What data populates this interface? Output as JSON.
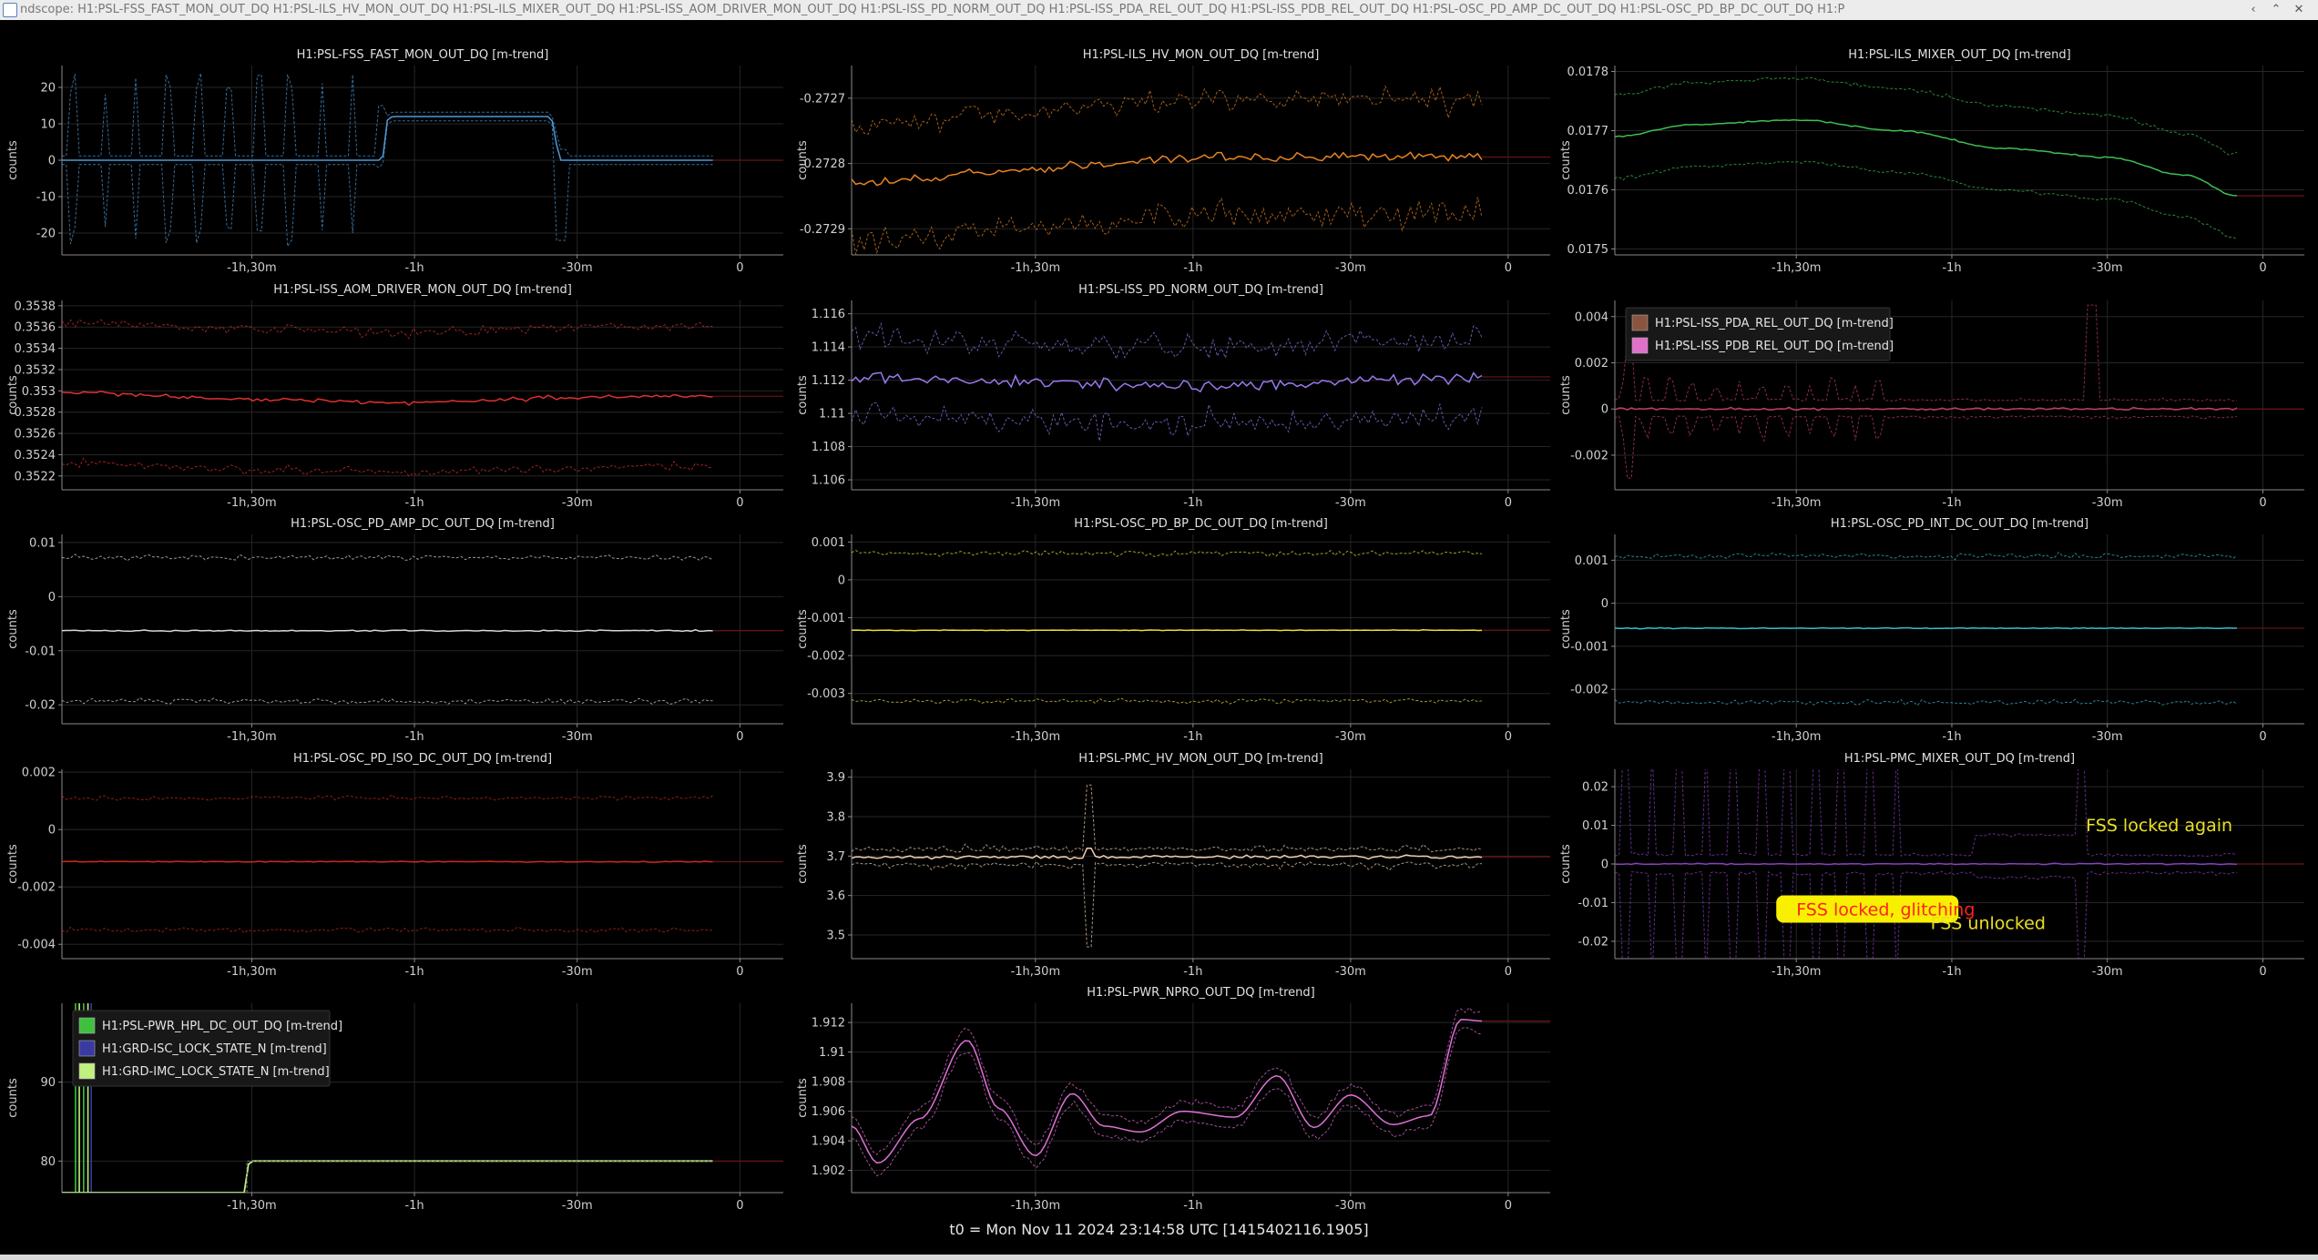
{
  "window": {
    "title": "ndscope: H1:PSL-FSS_FAST_MON_OUT_DQ H1:PSL-ILS_HV_MON_OUT_DQ H1:PSL-ILS_MIXER_OUT_DQ H1:PSL-ISS_AOM_DRIVER_MON_OUT_DQ H1:PSL-ISS_PD_NORM_OUT_DQ H1:PSL-ISS_PDA_REL_OUT_DQ H1:PSL-ISS_PDB_REL_OUT_DQ H1:PSL-OSC_PD_AMP_DC_OUT_DQ H1:PSL-OSC_PD_BP_DC_OUT_DQ H1:P",
    "minimize_glyph": "‹",
    "maximize_glyph": "⌃",
    "close_glyph": "✕"
  },
  "footer_text": "t0 = Mon Nov 11 2024 23:14:58 UTC [1415402116.1905]",
  "colors": {
    "background": "#000000",
    "grid": "#262626",
    "axis": "#8a8a8a",
    "zero_line": "#6b1515"
  },
  "x_axis": {
    "unit": "minutes relative to t0",
    "range": [
      -125,
      8
    ],
    "ticks": [
      -90,
      -60,
      -30,
      0
    ],
    "tick_labels": [
      "-1h,30m",
      "-1h",
      "-30m",
      "0"
    ],
    "data_end": -5
  },
  "chart_data": [
    {
      "type": "line",
      "title": "H1:PSL-FSS_FAST_MON_OUT_DQ [m-trend]",
      "ylabel": "counts",
      "ylim": [
        -26,
        26
      ],
      "yticks": [
        -20,
        -10,
        0,
        10,
        20
      ],
      "ytick_labels": [
        "-20",
        "-10",
        "0",
        "10",
        "20"
      ],
      "series": [
        {
          "color": "#4a9ad8",
          "kind": "fss_fast",
          "mean": [
            [
              -125,
              0
            ],
            [
              -66,
              0
            ],
            [
              -65,
              11
            ],
            [
              -64,
              12
            ],
            [
              -35,
              12
            ],
            [
              -33,
              0
            ],
            [
              -5,
              0
            ]
          ],
          "band": [
            -22,
            22
          ]
        }
      ]
    },
    {
      "type": "line",
      "title": "H1:PSL-ILS_HV_MON_OUT_DQ [m-trend]",
      "ylabel": "counts",
      "ylim": [
        -0.27294,
        -0.27265
      ],
      "yticks": [
        -0.2729,
        -0.2728,
        -0.2727
      ],
      "ytick_labels": [
        "-0.2729",
        "-0.2728",
        "-0.2727"
      ],
      "series": [
        {
          "color": "#e88420",
          "kind": "noisy",
          "mean": [
            [
              -125,
              -0.27283
            ],
            [
              -90,
              -0.27281
            ],
            [
              -60,
              -0.27279
            ],
            [
              -30,
              -0.27279
            ],
            [
              -5,
              -0.27279
            ]
          ],
          "noise": 7.5e-06,
          "band_offset": 8.5e-05
        }
      ]
    },
    {
      "type": "line",
      "title": "H1:PSL-ILS_MIXER_OUT_DQ [m-trend]",
      "ylabel": "counts",
      "ylim": [
        0.01749,
        0.01781
      ],
      "yticks": [
        0.0175,
        0.0176,
        0.0177,
        0.0178
      ],
      "ytick_labels": [
        "0.0175",
        "0.0176",
        "0.0177",
        "0.0178"
      ],
      "series": [
        {
          "color": "#3cc050",
          "kind": "smooth",
          "mean": [
            [
              -125,
              0.01769
            ],
            [
              -110,
              0.01771
            ],
            [
              -90,
              0.017718
            ],
            [
              -70,
              0.0177
            ],
            [
              -50,
              0.01767
            ],
            [
              -30,
              0.017655
            ],
            [
              -15,
              0.017625
            ],
            [
              -5,
              0.01759
            ]
          ],
          "noise": 1.2e-06,
          "band_offset": 7e-05
        }
      ]
    },
    {
      "type": "line",
      "title": "H1:PSL-ISS_AOM_DRIVER_MON_OUT_DQ [m-trend]",
      "ylabel": "counts",
      "ylim": [
        0.35207,
        0.35385
      ],
      "yticks": [
        0.3522,
        0.3524,
        0.3526,
        0.3528,
        0.353,
        0.3532,
        0.3534,
        0.3536,
        0.3538
      ],
      "ytick_labels": [
        "0.3522",
        "0.3524",
        "0.3526",
        "0.3528",
        "0.353",
        "0.3532",
        "0.3534",
        "0.3536",
        "0.3538"
      ],
      "series": [
        {
          "color": "#e03030",
          "kind": "noisy",
          "mean": [
            [
              -125,
              0.35299
            ],
            [
              -90,
              0.35292
            ],
            [
              -60,
              0.35289
            ],
            [
              -30,
              0.35294
            ],
            [
              -5,
              0.35295
            ]
          ],
          "noise": 1.8e-05,
          "band_offset": 0.00065
        }
      ]
    },
    {
      "type": "line",
      "title": "H1:PSL-ISS_PD_NORM_OUT_DQ [m-trend]",
      "ylabel": "counts",
      "ylim": [
        1.1054,
        1.1168
      ],
      "yticks": [
        1.106,
        1.108,
        1.11,
        1.112,
        1.114,
        1.116
      ],
      "ytick_labels": [
        "1.106",
        "1.108",
        "1.11",
        "1.112",
        "1.114",
        "1.116"
      ],
      "series": [
        {
          "color": "#9a78ee",
          "kind": "noisy",
          "mean": [
            [
              -125,
              1.1121
            ],
            [
              -60,
              1.1117
            ],
            [
              -30,
              1.1119
            ],
            [
              -5,
              1.1122
            ]
          ],
          "noise": 0.0003,
          "band_offset": 0.0022
        }
      ]
    },
    {
      "type": "line",
      "title": "",
      "ylabel": "counts",
      "ylim": [
        -0.0035,
        0.0047
      ],
      "yticks": [
        -0.002,
        0,
        0.002,
        0.004
      ],
      "ytick_labels": [
        "-0.002",
        "0",
        "0.002",
        "0.004"
      ],
      "legend": {
        "position": "top-left",
        "entries": [
          {
            "label": "H1:PSL-ISS_PDA_REL_OUT_DQ [m-trend]",
            "color": "#8a5540"
          },
          {
            "label": "H1:PSL-ISS_PDB_REL_OUT_DQ [m-trend]",
            "color": "#e070c8"
          }
        ]
      },
      "series": [
        {
          "color": "#c04060",
          "kind": "pd_rel",
          "mean": [
            [
              -125,
              0
            ],
            [
              -5,
              0
            ]
          ],
          "band": [
            -0.0004,
            0.0004
          ]
        }
      ]
    },
    {
      "type": "line",
      "title": "H1:PSL-OSC_PD_AMP_DC_OUT_DQ [m-trend]",
      "ylabel": "counts",
      "ylim": [
        -0.0235,
        0.0115
      ],
      "yticks": [
        -0.02,
        -0.01,
        0,
        0.01
      ],
      "ytick_labels": [
        "-0.02",
        "-0.01",
        "0",
        "0.01"
      ],
      "series": [
        {
          "color": "#d8d8d8",
          "kind": "noisy",
          "mean": [
            [
              -125,
              -0.0063
            ],
            [
              -5,
              -0.0063
            ]
          ],
          "noise": 0.00012,
          "band_upper": 0.0072,
          "band_lower": -0.0193
        }
      ]
    },
    {
      "type": "line",
      "title": "H1:PSL-OSC_PD_BP_DC_OUT_DQ [m-trend]",
      "ylabel": "counts",
      "ylim": [
        -0.0038,
        0.0012
      ],
      "yticks": [
        -0.003,
        -0.002,
        -0.001,
        0,
        0.001
      ],
      "ytick_labels": [
        "-0.003",
        "-0.002",
        "-0.001",
        "0",
        "0.001"
      ],
      "series": [
        {
          "color": "#e8e030",
          "kind": "noisy",
          "mean": [
            [
              -125,
              -0.00133
            ],
            [
              -5,
              -0.00133
            ]
          ],
          "noise": 8e-06,
          "band_upper": 0.0007,
          "band_lower": -0.0032
        }
      ]
    },
    {
      "type": "line",
      "title": "H1:PSL-OSC_PD_INT_DC_OUT_DQ [m-trend]",
      "ylabel": "counts",
      "ylim": [
        -0.0028,
        0.0016
      ],
      "yticks": [
        -0.002,
        -0.001,
        0,
        0.001
      ],
      "ytick_labels": [
        "-0.002",
        "-0.001",
        "0",
        "0.001"
      ],
      "series": [
        {
          "color": "#30c0d0",
          "kind": "noisy",
          "mean": [
            [
              -125,
              -0.00058
            ],
            [
              -5,
              -0.00058
            ]
          ],
          "noise": 1e-05,
          "band_upper": 0.0011,
          "band_lower": -0.0023
        }
      ]
    },
    {
      "type": "line",
      "title": "H1:PSL-OSC_PD_ISO_DC_OUT_DQ [m-trend]",
      "ylabel": "counts",
      "ylim": [
        -0.0045,
        0.0021
      ],
      "yticks": [
        -0.004,
        -0.002,
        0,
        0.002
      ],
      "ytick_labels": [
        "-0.004",
        "-0.002",
        "0",
        "0.002"
      ],
      "series": [
        {
          "color": "#d02820",
          "kind": "noisy",
          "mean": [
            [
              -125,
              -0.00112
            ],
            [
              -5,
              -0.00112
            ]
          ],
          "noise": 1.5e-05,
          "band_upper": 0.0011,
          "band_lower": -0.0035
        }
      ]
    },
    {
      "type": "line",
      "title": "H1:PSL-PMC_HV_MON_OUT_DQ [m-trend]",
      "ylabel": "counts",
      "ylim": [
        3.44,
        3.92
      ],
      "yticks": [
        3.5,
        3.6,
        3.7,
        3.8,
        3.9
      ],
      "ytick_labels": [
        "3.5",
        "3.6",
        "3.7",
        "3.8",
        "3.9"
      ],
      "series": [
        {
          "color": "#f0d0b0",
          "kind": "pmc_hv",
          "mean": [
            [
              -125,
              3.698
            ],
            [
              -5,
              3.698
            ]
          ],
          "noise": 0.004,
          "band_offset": 0.015
        }
      ]
    },
    {
      "type": "line",
      "title": "H1:PSL-PMC_MIXER_OUT_DQ [m-trend]",
      "ylabel": "counts",
      "ylim": [
        -0.0245,
        0.0245
      ],
      "yticks": [
        -0.02,
        -0.01,
        0,
        0.01,
        0.02
      ],
      "ytick_labels": [
        "-0.02",
        "-0.01",
        "0",
        "0.01",
        "0.02"
      ],
      "series": [
        {
          "color": "#8a40c0",
          "kind": "pmc_mixer",
          "mean": [
            [
              -125,
              0
            ],
            [
              -5,
              0
            ]
          ],
          "band": [
            -0.006,
            0.006
          ]
        }
      ],
      "annotations": [
        {
          "text": "FSS locked again",
          "x": -20,
          "y": 0.0085,
          "color": "#e8e020",
          "size": 19
        },
        {
          "text": "FSS locked, glitching",
          "x": -90,
          "y": -0.0133,
          "color": "#ff2020",
          "size": 19,
          "highlight": "#f8f000"
        },
        {
          "text": "FSS unlocked",
          "x": -53,
          "y": -0.0168,
          "color": "#e8e020",
          "size": 19
        }
      ]
    },
    {
      "type": "line",
      "title": "",
      "ylabel": "counts",
      "ylim": [
        76,
        100
      ],
      "yticks": [
        80,
        90
      ],
      "ytick_labels": [
        "80",
        "90"
      ],
      "legend": {
        "position": "top-left",
        "entries": [
          {
            "label": "H1:PSL-PWR_HPL_DC_OUT_DQ [m-trend]",
            "color": "#40c040"
          },
          {
            "label": "H1:GRD-ISC_LOCK_STATE_N [m-trend]",
            "color": "#3a3aa0"
          },
          {
            "label": "H1:GRD-IMC_LOCK_STATE_N [m-trend]",
            "color": "#c0f080"
          }
        ]
      },
      "series": [
        {
          "color": "#c0f080",
          "kind": "grd_step",
          "mean": [
            [
              -125,
              76
            ],
            [
              -91,
              76
            ],
            [
              -90.5,
              80
            ],
            [
              -5,
              80
            ]
          ]
        }
      ]
    },
    {
      "type": "line",
      "title": "H1:PSL-PWR_NPRO_OUT_DQ [m-trend]",
      "ylabel": "counts",
      "ylim": [
        1.9005,
        1.9133
      ],
      "yticks": [
        1.902,
        1.904,
        1.906,
        1.908,
        1.91,
        1.912
      ],
      "ytick_labels": [
        "1.902",
        "1.904",
        "1.906",
        "1.908",
        "1.91",
        "1.912"
      ],
      "series": [
        {
          "color": "#e070d8",
          "kind": "smooth_wavy",
          "mean": [
            [
              -125,
              1.905
            ],
            [
              -120,
              1.9025
            ],
            [
              -112,
              1.9055
            ],
            [
              -103,
              1.9108
            ],
            [
              -97,
              1.9062
            ],
            [
              -90,
              1.903
            ],
            [
              -83,
              1.9072
            ],
            [
              -77,
              1.905
            ],
            [
              -70,
              1.9046
            ],
            [
              -62,
              1.906
            ],
            [
              -52,
              1.9056
            ],
            [
              -44,
              1.9084
            ],
            [
              -37,
              1.9049
            ],
            [
              -30,
              1.9071
            ],
            [
              -22,
              1.9051
            ],
            [
              -15,
              1.9057
            ],
            [
              -9,
              1.9122
            ],
            [
              -5,
              1.9121
            ]
          ],
          "band_offset": 0.0008
        }
      ]
    },
    {
      "type": "empty",
      "title": ""
    }
  ]
}
